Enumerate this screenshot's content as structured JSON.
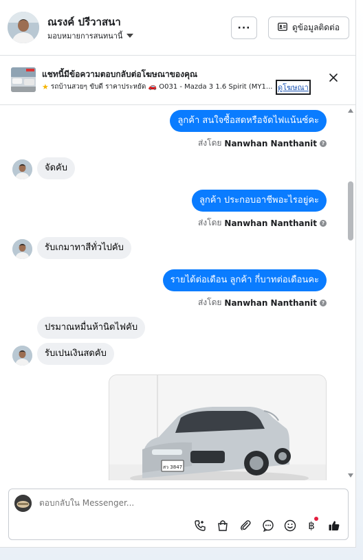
{
  "header": {
    "name": "ณรงค์ ปรีวาสนา",
    "assign_label": "มอบหมายการสนทนานี้",
    "more_label": "···",
    "contact_button_label": "ดูข้อมูลติดต่อ"
  },
  "ad_banner": {
    "title": "แชทนี้มีข้อความตอบกลับต่อโฆษณาของคุณ",
    "subtitle": "รถบ้านสวยๆ ขับดี ราคาประหยัด 🚗 O031 - Mazda 3 1.6 Spirit (MY1...",
    "link_label": "ดูโฆษณา"
  },
  "messages": [
    {
      "direction": "out",
      "text": "ลูกค้า สนใจซื้อสดหรือจัดไฟแน้นซ์คะ",
      "sent_by_prefix": "ส่งโดย",
      "sent_by_name": "Nanwhan Nanthanit"
    },
    {
      "direction": "in",
      "text": "จัดคับ"
    },
    {
      "direction": "out",
      "text": "ลูกค้า ประกอบอาชีพอะไรอยู่คะ",
      "sent_by_prefix": "ส่งโดย",
      "sent_by_name": "Nanwhan Nanthanit"
    },
    {
      "direction": "in",
      "text": "รับเกมาทาสีทั่วไปคับ"
    },
    {
      "direction": "out",
      "text": "รายได้ต่อเดือน ลูกค้า กี่บาทต่อเดือนคะ",
      "sent_by_prefix": "ส่งโดย",
      "sent_by_name": "Nanwhan Nanthanit"
    },
    {
      "direction": "in",
      "text": "ปรมาณหมื่นห้านิดไฟคับ"
    },
    {
      "direction": "in",
      "text": "รับเปนเงินสดคับ"
    }
  ],
  "car_photo": {
    "plate": "สว 3847"
  },
  "composer": {
    "placeholder": "ตอบกลับใน Messenger...",
    "tools": [
      "phone-icon",
      "bag-icon",
      "paperclip-icon",
      "chat-icon",
      "emoji-icon",
      "baht-icon",
      "thumbs-up-icon"
    ]
  },
  "colors": {
    "outgoing_bubble": "#0a7cff",
    "incoming_bubble": "#eef0f3",
    "link": "#1a54b3"
  }
}
